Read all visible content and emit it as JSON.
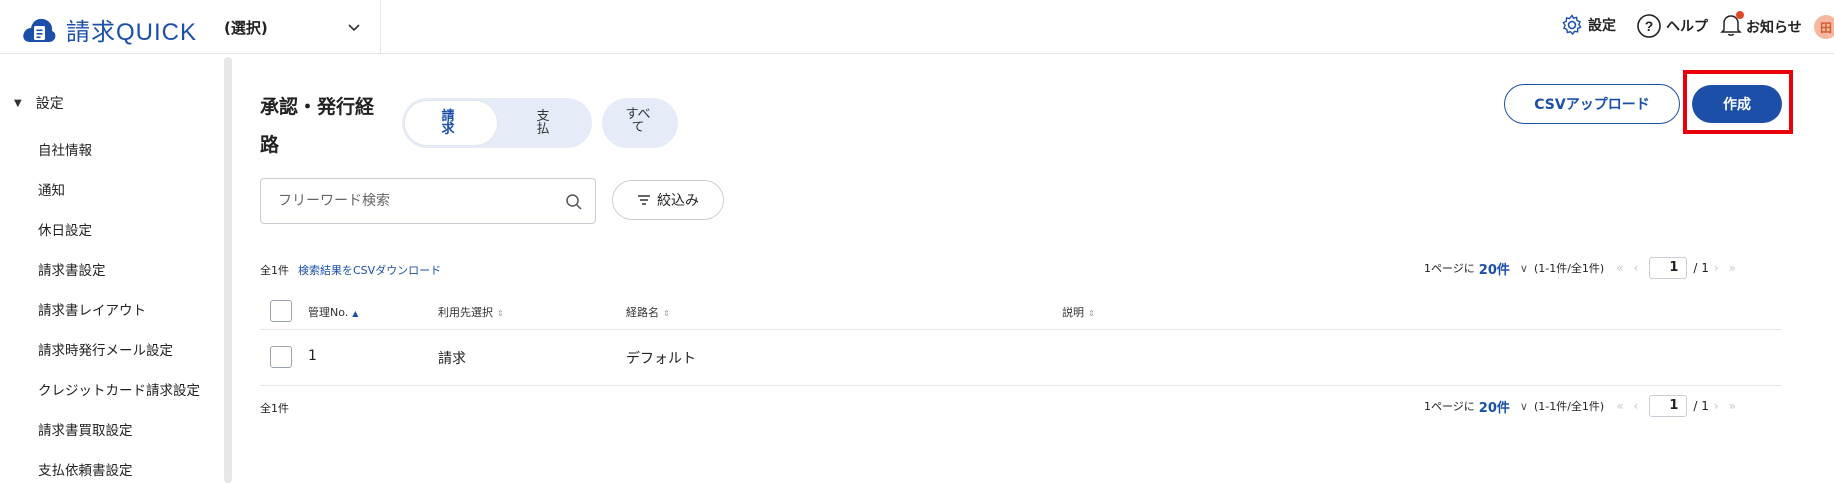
{
  "header": {
    "logo_text": "請求QUICK",
    "company_select": "(選択)",
    "settings_label": "設定",
    "help_label": "ヘルプ",
    "notifications_label": "お知らせ",
    "avatar_initial": "田"
  },
  "sidebar": {
    "section_label": "設定",
    "items": [
      {
        "label": "自社情報"
      },
      {
        "label": "通知"
      },
      {
        "label": "休日設定"
      },
      {
        "label": "請求書設定"
      },
      {
        "label": "請求書レイアウト"
      },
      {
        "label": "請求時発行メール設定"
      },
      {
        "label": "クレジットカード請求設定"
      },
      {
        "label": "請求書買取設定"
      },
      {
        "label": "支払依頼書設定"
      }
    ]
  },
  "main": {
    "title": "承認・発行経路",
    "tabs": [
      {
        "label": "請求",
        "active": true
      },
      {
        "label": "支払",
        "active": false
      },
      {
        "label": "すべて",
        "active": false
      }
    ],
    "csv_upload_label": "CSVアップロード",
    "create_label": "作成",
    "search_placeholder": "フリーワード検索",
    "filter_label": "絞込み",
    "result_count_top": "全1件",
    "csv_download_link": "検索結果をCSVダウンロード",
    "result_count_bottom": "全1件",
    "pager": {
      "per_page_prefix": "1ページに",
      "per_page": "20件",
      "range": "(1-1件/全1件)",
      "page": "1",
      "total_pages": "/ 1"
    },
    "table": {
      "columns": [
        "管理No.",
        "利用先選択",
        "経路名",
        "説明"
      ],
      "rows": [
        {
          "no": "1",
          "usage": "請求",
          "route_name": "デフォルト",
          "description": ""
        }
      ]
    }
  },
  "colors": {
    "brand": "#1b4fa8",
    "highlight": "#e8000b",
    "tab_background": "#e6ecf7"
  }
}
